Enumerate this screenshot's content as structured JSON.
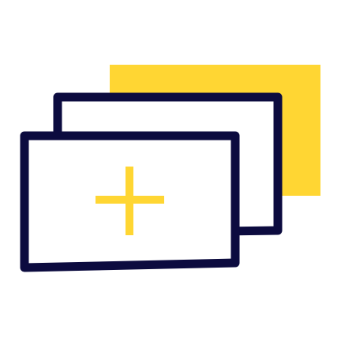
{
  "icon": {
    "name": "add-card-stack-icon",
    "parts": [
      "back-card-yellow",
      "middle-card-outline",
      "front-card-outline",
      "plus-sign"
    ]
  },
  "colors": {
    "background": "#ffffff",
    "accent": "#ffd633",
    "outline": "#0c0b3f",
    "card_fill": "#ffffff"
  }
}
